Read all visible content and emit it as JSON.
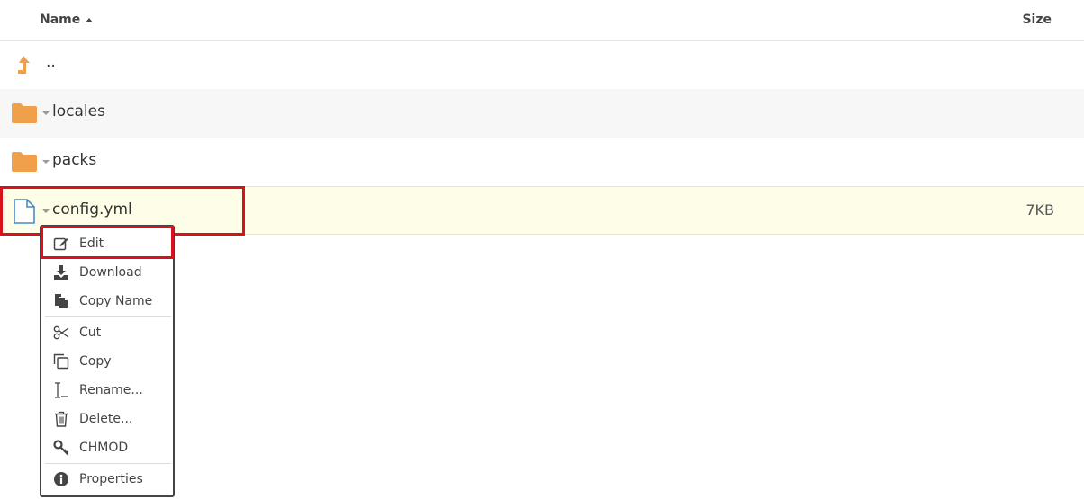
{
  "header": {
    "name_label": "Name",
    "size_label": "Size"
  },
  "files": [
    {
      "name": "..",
      "type": "parent-folder",
      "size": ""
    },
    {
      "name": "locales",
      "type": "folder",
      "size": ""
    },
    {
      "name": "packs",
      "type": "folder",
      "size": ""
    },
    {
      "name": "config.yml",
      "type": "file",
      "size": "7KB"
    }
  ],
  "context_menu": {
    "items": [
      {
        "label": "Edit",
        "icon": "edit-icon"
      },
      {
        "label": "Download",
        "icon": "download-icon"
      },
      {
        "label": "Copy Name",
        "icon": "copy-name-icon"
      },
      {
        "label": "Cut",
        "icon": "scissors-icon"
      },
      {
        "label": "Copy",
        "icon": "copy-icon"
      },
      {
        "label": "Rename...",
        "icon": "rename-icon"
      },
      {
        "label": "Delete...",
        "icon": "trash-icon"
      },
      {
        "label": "CHMOD",
        "icon": "key-icon"
      },
      {
        "label": "Properties",
        "icon": "info-icon"
      }
    ]
  },
  "colors": {
    "folder": "#f0a04b",
    "file_outline": "#4a8ac4",
    "highlight": "#d8121c",
    "selected_row": "#fefee8"
  }
}
